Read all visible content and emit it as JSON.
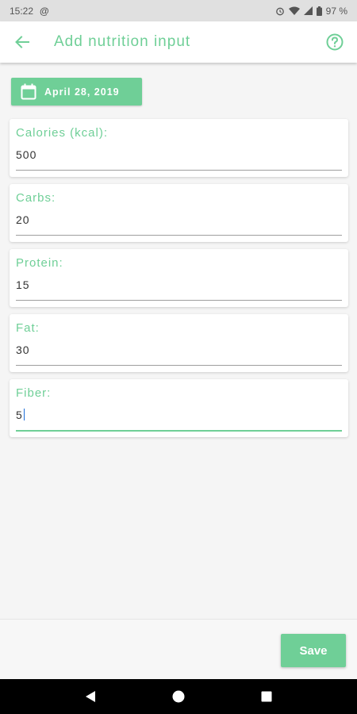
{
  "status_bar": {
    "time": "15:22",
    "notification_symbol": "@",
    "battery_text": "97 %"
  },
  "app_bar": {
    "title": "Add nutrition input",
    "back_icon": "arrow-back-icon",
    "help_icon": "help-circle-icon"
  },
  "date_button": {
    "label": "April 28, 2019",
    "icon": "calendar-icon"
  },
  "fields": [
    {
      "label": "Calories (kcal):",
      "value": "500"
    },
    {
      "label": "Carbs:",
      "value": "20"
    },
    {
      "label": "Protein:",
      "value": "15"
    },
    {
      "label": "Fat:",
      "value": "30"
    },
    {
      "label": "Fiber:",
      "value": "5"
    }
  ],
  "save_label": "Save",
  "colors": {
    "accent": "#6fcf97",
    "background": "#f5f5f5",
    "status_bar": "#e0e0e0",
    "nav_bar": "#000000",
    "cursor": "#1e6fd9"
  }
}
